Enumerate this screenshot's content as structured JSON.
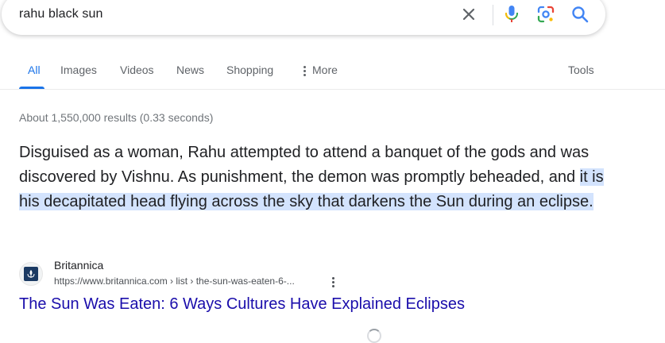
{
  "search": {
    "query": "rahu black sun"
  },
  "icons": {
    "clear": "close-icon",
    "voice": "microphone-icon",
    "lens": "camera-lens-icon",
    "search": "search-icon"
  },
  "tabs": [
    {
      "label": "All",
      "active": true
    },
    {
      "label": "Images"
    },
    {
      "label": "Videos"
    },
    {
      "label": "News"
    },
    {
      "label": "Shopping"
    },
    {
      "label": "More"
    }
  ],
  "tools_label": "Tools",
  "result_stats": "About 1,550,000 results (0.33 seconds)",
  "featured_snippet": {
    "text_before": "Disguised as a woman, Rahu attempted to attend a banquet of the gods and was discovered by Vishnu. As punishment, the demon was promptly beheaded, and ",
    "text_highlight": "it is his decapitated head flying across the sky that darkens the Sun during an eclipse."
  },
  "result": {
    "site_name": "Britannica",
    "url": "https://www.britannica.com › list › the-sun-was-eaten-6-...",
    "title": "The Sun Was Eaten: 6 Ways Cultures Have Explained Eclipses"
  },
  "colors": {
    "accent": "#1a73e8",
    "link": "#1a0dab",
    "highlight": "#d3e3fd"
  }
}
